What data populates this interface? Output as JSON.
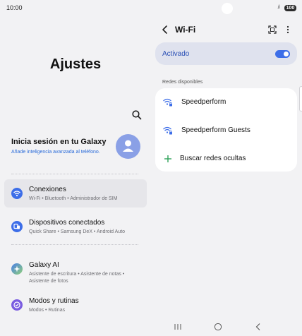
{
  "statusbar": {
    "time": "10:00",
    "battery": "100",
    "signal_icon": "signal-icon",
    "camera_icon": "front-camera-icon"
  },
  "left": {
    "title": "Ajustes",
    "search_icon": "search-icon",
    "profile": {
      "title": "Inicia sesión en tu Galaxy",
      "subtitle": "Añade inteligencia avanzada al teléfono.",
      "avatar_icon": "person-icon"
    },
    "items": [
      {
        "title": "Conexiones",
        "subtitle": "Wi-Fi  •  Bluetooth  •  Administrador de SIM",
        "icon": "wifi-icon",
        "color": "#3d6ee8",
        "selected": true
      },
      {
        "title": "Dispositivos conectados",
        "subtitle": "Quick Share  •  Samsung DeX  •  Android Auto",
        "icon": "devices-icon",
        "color": "#3d6ee8"
      },
      {
        "title": "Galaxy AI",
        "subtitle": "Asistente de escritura  •  Asistente de notas  •  Asistente de fotos",
        "icon": "sparkle-icon",
        "color": "#6a8fdc"
      },
      {
        "title": "Modos y rutinas",
        "subtitle": "Modos  •  Rutinas",
        "icon": "check-circle-icon",
        "color": "#7a5ce0"
      }
    ]
  },
  "right": {
    "title": "Wi-Fi",
    "toggle": {
      "label": "Activado",
      "on": true
    },
    "section_label": "Redes disponibles",
    "networks": [
      {
        "name": "Speedperform",
        "icon": "wifi-lock-icon"
      },
      {
        "name": "Speedperform Guests",
        "icon": "wifi-lock-icon"
      }
    ],
    "hidden_action": {
      "label": "Buscar redes ocultas",
      "icon": "plus-icon"
    },
    "accent": "#3d6ee8",
    "add_color": "#2fa35b"
  },
  "navbar": {
    "recent_icon": "recent-apps-icon",
    "home_icon": "home-icon",
    "back_icon": "back-icon"
  }
}
